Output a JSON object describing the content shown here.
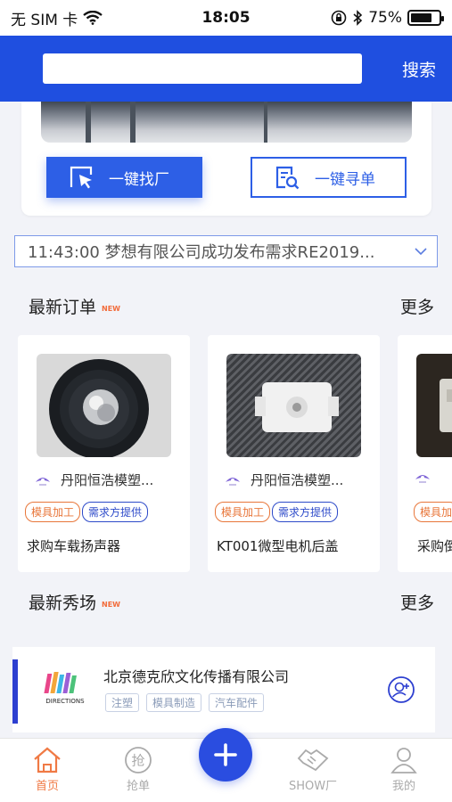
{
  "status_bar": {
    "carrier": "无 SIM 卡",
    "time": "18:05",
    "battery_percent": "75%",
    "battery_level": 0.75,
    "icons": [
      "wifi-icon",
      "orientation-lock-icon",
      "bluetooth-icon",
      "battery-icon"
    ]
  },
  "header": {
    "search_placeholder": "",
    "search_button": "搜索",
    "accent": "#1f4fe0"
  },
  "top_card": {
    "find_factory_label": "一键找厂",
    "find_order_label": "一键寻单"
  },
  "ticker": {
    "text": "11:43:00 梦想有限公司成功发布需求RE2019..."
  },
  "latest_orders": {
    "title": "最新订单",
    "new_tag": "NEW",
    "more": "更多",
    "items": [
      {
        "company": "丹阳恒浩模塑...",
        "tags": [
          "模具加工",
          "需求方提供"
        ],
        "title": "求购车载扬声器"
      },
      {
        "company": "丹阳恒浩模塑...",
        "tags": [
          "模具加工",
          "需求方提供"
        ],
        "title": "KT001微型电机后盖"
      },
      {
        "company": "",
        "tags": [
          "模具加"
        ],
        "title": "采购倒"
      }
    ]
  },
  "latest_show": {
    "title": "最新秀场",
    "new_tag": "NEW",
    "more": "更多",
    "company": "北京德克欣文化传播有限公司",
    "tags": [
      "注塑",
      "模具制造",
      "汽车配件"
    ],
    "logo_text": "DIRECTIONS"
  },
  "tab_bar": {
    "tabs": [
      {
        "label": "首页",
        "icon": "home-icon",
        "active": true
      },
      {
        "label": "抢单",
        "icon": "grab-order-icon",
        "active": false
      },
      {
        "label": "SHOW厂",
        "icon": "handshake-icon",
        "active": false
      },
      {
        "label": "我的",
        "icon": "profile-icon",
        "active": false
      }
    ],
    "fab_icon": "plus-icon",
    "active_color": "#f07a45"
  }
}
